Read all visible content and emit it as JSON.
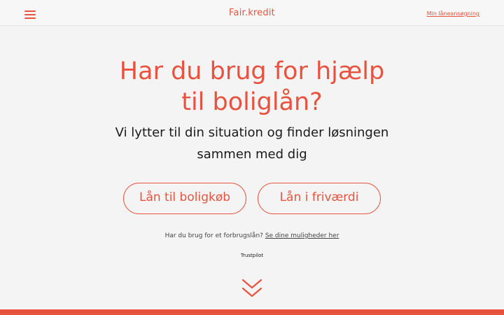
{
  "header": {
    "menu_icon": "hamburger-menu-icon",
    "logo": "Fair.kredit",
    "account_link": "Min låneansøgning"
  },
  "hero": {
    "title_line1": "Har du brug for hjælp",
    "title_line2": "til boliglån?",
    "subtitle_line1": "Vi lytter til din situation og finder løsningen",
    "subtitle_line2": "sammen med dig"
  },
  "buttons": {
    "home_purchase": "Lån til boligkøb",
    "equity": "Lån i friværdi"
  },
  "consumer_loan": {
    "text": "Har du brug for et forbrugslån?",
    "link": "Se dine muligheder her"
  },
  "trustpilot": "Trustpilot",
  "scroll_icon": "double-chevron-down-icon",
  "colors": {
    "accent": "#e8533f",
    "background": "#f4f4f4",
    "text": "#1a1a1a"
  }
}
